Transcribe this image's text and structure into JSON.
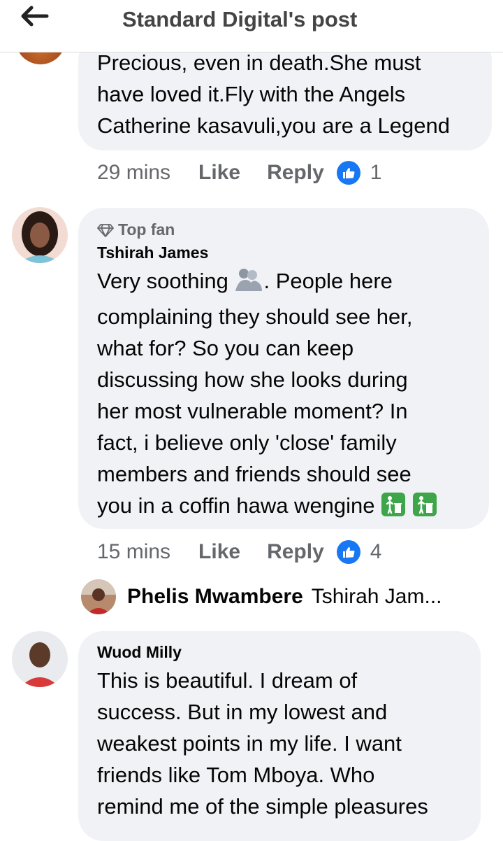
{
  "header": {
    "title": "Standard Digital's post"
  },
  "comment1": {
    "lines": [
      "Precious, even in death.She must",
      "have loved it.Fly with the Angels",
      "Catherine kasavuli,you are a Legend"
    ],
    "time": "29 mins",
    "like_label": "Like",
    "reply_label": "Reply",
    "reaction_count": "1"
  },
  "comment2": {
    "badge": "Top fan",
    "author": "Tshirah James",
    "line1_before": "Very soothing ",
    "line1_after": ". People here",
    "lines": [
      "complaining they should see her,",
      "what for? So you can keep",
      "discussing how she looks during",
      "her most vulnerable moment?  In",
      "fact, i believe only 'close' family",
      "members and friends should see"
    ],
    "last_line": "you in a coffin hawa wengine ",
    "time": "15 mins",
    "like_label": "Like",
    "reply_label": "Reply",
    "reaction_count": "4"
  },
  "reply_preview": {
    "author": "Phelis Mwambere",
    "text": "Tshirah Jam..."
  },
  "comment3": {
    "author": "Wuod Milly",
    "lines": [
      "This is beautiful. I dream of",
      "success. But in my lowest and",
      "weakest points in my life. I want",
      "friends like Tom Mboya. Who",
      "remind me of the simple pleasures"
    ]
  },
  "icons": {
    "back": "arrow-left-icon",
    "like_reaction": "thumbs-up-icon",
    "badge": "diamond-icon",
    "emoji_hug": "people-hugging-emoji",
    "emoji_litter": "put-litter-in-bin-emoji"
  },
  "colors": {
    "accent": "#1877f2",
    "bubble": "#f0f2f5",
    "meta": "#65676b",
    "litter_green": "#3ea54a"
  }
}
